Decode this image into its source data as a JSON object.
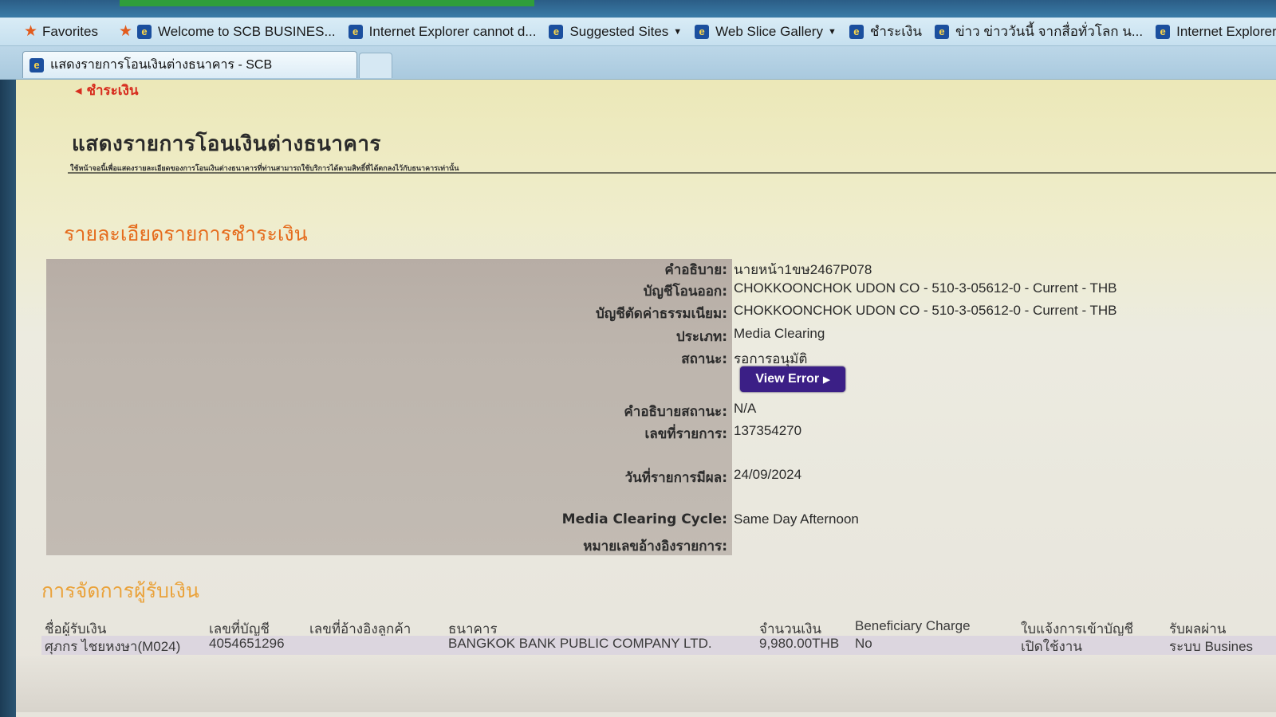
{
  "browser": {
    "favorites_label": "Favorites",
    "favorites": [
      {
        "label": "Welcome to SCB BUSINES...",
        "dropdown": false
      },
      {
        "label": "Internet Explorer cannot d...",
        "dropdown": false
      },
      {
        "label": "Suggested Sites",
        "dropdown": true
      },
      {
        "label": "Web Slice Gallery",
        "dropdown": true
      },
      {
        "label": "ชำระเงิน",
        "dropdown": false
      },
      {
        "label": "ข่าว ข่าววันนี้ จากสื่อทั่วโลก น...",
        "dropdown": false
      },
      {
        "label": "Internet Explorer canno",
        "dropdown": false
      }
    ],
    "active_tab": "แสดงรายการโอนเงินต่างธนาคาร - SCB"
  },
  "page": {
    "breadcrumb": "◂ ชำระเงิน",
    "title": "แสดงรายการโอนเงินต่างธนาคาร",
    "description": "ใช้หน้าจอนี้เพื่อแสดงรายละเอียดของการโอนเงินต่างธนาคารที่ท่านสามารถใช้บริการได้ตามสิทธิ์ที่ได้ตกลงไว้กับธนาคารเท่านั้น"
  },
  "details": {
    "heading": "รายละเอียดรายการชำระเงิน",
    "rows": [
      {
        "label": "คำอธิบาย:",
        "value": "นายหน้า1ขษ2467P078"
      },
      {
        "label": "บัญชีโอนออก:",
        "value": "CHOKKOONCHOK UDON CO - 510-3-05612-0 - Current - THB"
      },
      {
        "label": "บัญชีตัดค่าธรรมเนียม:",
        "value": "CHOKKOONCHOK UDON CO - 510-3-05612-0 - Current - THB"
      },
      {
        "label": "ประเภท:",
        "value": "Media Clearing"
      },
      {
        "label": "สถานะ:",
        "value": "รอการอนุมัติ"
      },
      {
        "label": "คำอธิบายสถานะ:",
        "value": "N/A"
      },
      {
        "label": "เลขที่รายการ:",
        "value": "137354270"
      },
      {
        "label": "วันที่รายการมีผล:",
        "value": "24/09/2024"
      },
      {
        "label": "Media Clearing Cycle:",
        "value": "Same Day Afternoon"
      },
      {
        "label": "หมายเลขอ้างอิงรายการ:",
        "value": ""
      }
    ],
    "view_error_label": "View Error"
  },
  "payees": {
    "heading": "การจัดการผู้รับเงิน",
    "columns": [
      "ชื่อผู้รับเงิน",
      "เลขที่บัญชี",
      "เลขที่อ้างอิงลูกค้า",
      "ธนาคาร",
      "จำนวนเงิน",
      "Beneficiary Charge",
      "ใบแจ้งการเข้าบัญชี",
      "รับผลผ่าน"
    ],
    "rows": [
      [
        "ศุภกร ไชยหงษา(M024)",
        "4054651296",
        "",
        "BANGKOK BANK PUBLIC COMPANY LTD.",
        "9,980.00THB",
        "No",
        "เปิดใช้งาน",
        "ระบบ Busines"
      ]
    ]
  }
}
